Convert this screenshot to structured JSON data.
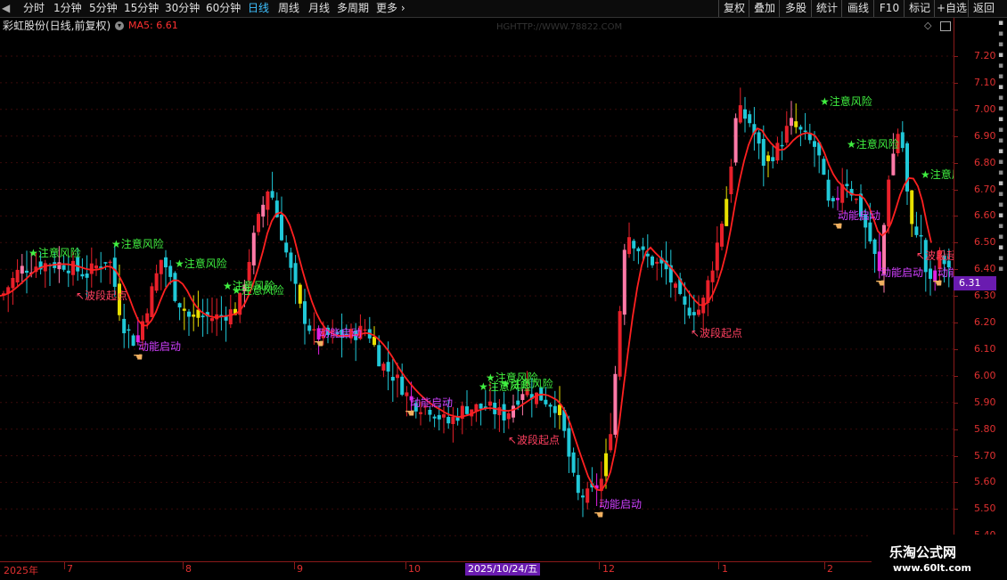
{
  "toolbar": {
    "periods": [
      "分时",
      "1分钟",
      "5分钟",
      "15分钟",
      "30分钟",
      "60分钟",
      "日线",
      "周线",
      "月线",
      "多周期",
      "更多"
    ],
    "active_period": "日线",
    "right_buttons": [
      "复权",
      "叠加",
      "多股",
      "统计",
      "画线",
      "F10",
      "标记",
      "+自选",
      "返回"
    ]
  },
  "info": {
    "title": "彩虹股份(日线,前复权)",
    "ma_label": "MA5: 6.61",
    "watermark_url": "HGHTTP://WWW.78822.COM"
  },
  "price_axis": {
    "ticks": [
      "7.20",
      "7.10",
      "7.00",
      "6.90",
      "6.80",
      "6.70",
      "6.60",
      "6.50",
      "6.40",
      "6.30",
      "6.20",
      "6.10",
      "6.00",
      "5.90",
      "5.80",
      "5.70",
      "5.60",
      "5.50",
      "5.40"
    ],
    "current_price": "6.31"
  },
  "date_axis": {
    "labels": [
      "2025年",
      "7",
      "8",
      "9",
      "10",
      "1",
      "2"
    ],
    "highlight": "2025/10/24/五",
    "label_12": "12"
  },
  "annotations": {
    "risk": "注意风险",
    "momentum": "动能启动",
    "wave": "波段起点"
  },
  "brand": {
    "name": "乐淘公式网",
    "url": "www.60lt.com"
  },
  "colors": {
    "up": "#e8202a",
    "down": "#20c8d8",
    "ma": "#ff2020",
    "yellow": "#e8e000",
    "magenta": "#e020e0",
    "pink": "#ff7aa8",
    "risk_text": "#40f040",
    "signal_text": "#d040ff",
    "wave_text": "#ff4060"
  },
  "chart_data": {
    "type": "candlestick",
    "series": [
      {
        "name": "MA5",
        "values": []
      }
    ]
  }
}
